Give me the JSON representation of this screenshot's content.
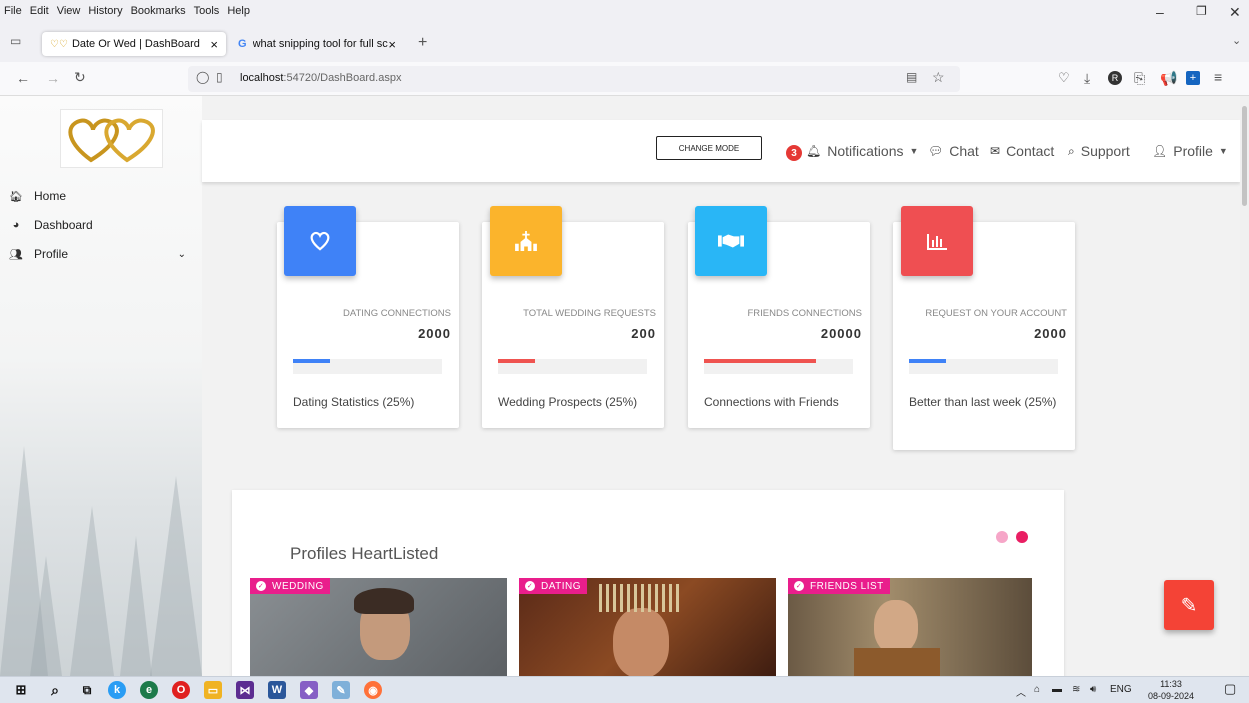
{
  "menubar": {
    "items": [
      "File",
      "Edit",
      "View",
      "History",
      "Bookmarks",
      "Tools",
      "Help"
    ]
  },
  "tabs": [
    {
      "title": "Date Or Wed | DashBoard",
      "close": "×",
      "icon": "heart-logo-icon"
    },
    {
      "title": "what snipping tool for full scree",
      "close": "×",
      "icon": "google-icon"
    }
  ],
  "new_tab": "+",
  "address": {
    "host": "localhost",
    "path": ":54720/DashBoard.aspx"
  },
  "sidebar": {
    "items": [
      {
        "label": "Home",
        "icon": "home-icon"
      },
      {
        "label": "Dashboard",
        "icon": "dashboard-icon"
      },
      {
        "label": "Profile",
        "icon": "users-icon"
      }
    ]
  },
  "topnav": {
    "change_mode": "CHANGE MODE",
    "notif_count": "3",
    "notifications": "Notifications",
    "chat": "Chat",
    "contact": "Contact",
    "support": "Support",
    "profile": "Profile"
  },
  "cards": [
    {
      "category": "DATING CONNECTIONS",
      "value": "2000",
      "progress": 0.25,
      "footer": "Dating Statistics (25%)",
      "color": "#3f82f7",
      "bar_color": "#3f82f7",
      "icon": "heart-icon"
    },
    {
      "category": "TOTAL WEDDING REQUESTS",
      "value": "200",
      "progress": 0.25,
      "footer": "Wedding Prospects (25%)",
      "color": "#fbb42c",
      "bar_color": "#ef5350",
      "icon": "church-icon"
    },
    {
      "category": "FRIENDS CONNECTIONS",
      "value": "20000",
      "progress": 0.75,
      "footer": "Connections with Friends",
      "color": "#29b6f6",
      "bar_color": "#ef5350",
      "icon": "handshake-icon"
    },
    {
      "category": "REQUEST ON YOUR ACCOUNT",
      "value": "2000",
      "progress": 0.25,
      "footer": "Better than last week (25%)",
      "color": "#ef4f52",
      "bar_color": "#3f82f7",
      "icon": "bar-chart-icon"
    }
  ],
  "profiles": {
    "title": "Profiles HeartListed",
    "items": [
      {
        "tag": "WEDDING"
      },
      {
        "tag": "DATING"
      },
      {
        "tag": "FRIENDS LIST"
      }
    ]
  },
  "taskbar": {
    "lang": "ENG",
    "time": "11:33",
    "date": "08-09-2024"
  }
}
